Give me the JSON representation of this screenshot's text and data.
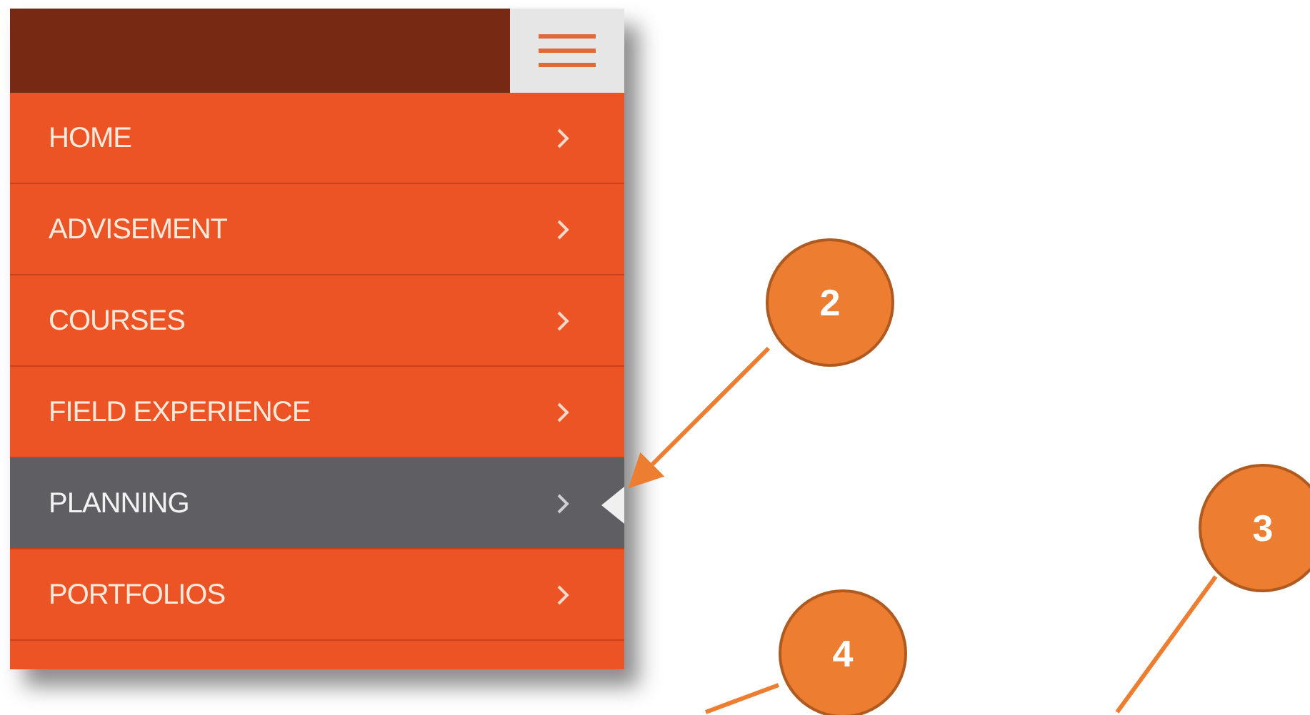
{
  "menu": {
    "items": [
      {
        "label": "HOME",
        "selected": false
      },
      {
        "label": "ADVISEMENT",
        "selected": false
      },
      {
        "label": "COURSES",
        "selected": false
      },
      {
        "label": "FIELD EXPERIENCE",
        "selected": false
      },
      {
        "label": "PLANNING",
        "selected": true
      },
      {
        "label": "PORTFOLIOS",
        "selected": false
      }
    ]
  },
  "callouts": [
    {
      "label": "2"
    },
    {
      "label": "3"
    },
    {
      "label": "4"
    }
  ]
}
